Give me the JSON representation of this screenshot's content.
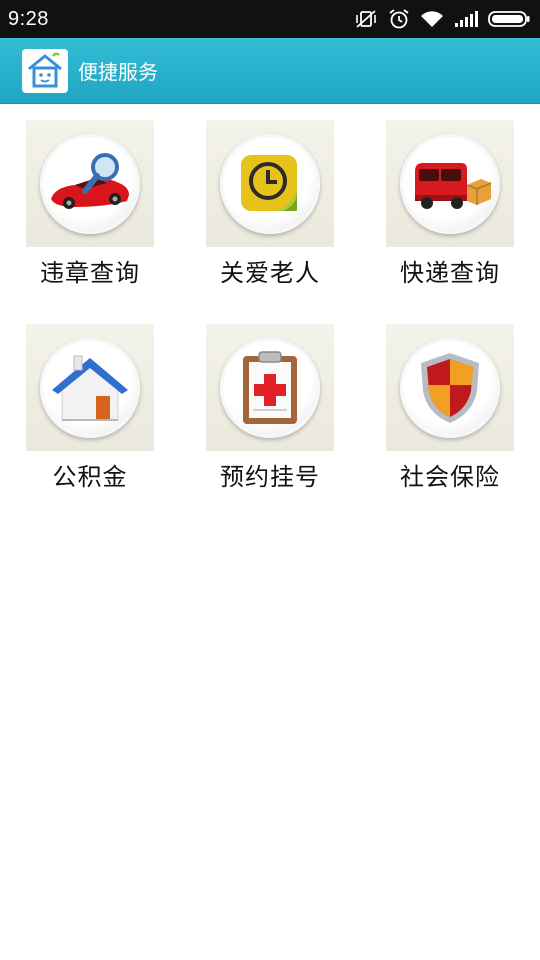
{
  "status_bar": {
    "time": "9:28",
    "icons": [
      "vibrate-off-icon",
      "alarm-icon",
      "wifi-icon",
      "signal-icon",
      "battery-icon"
    ]
  },
  "app_bar": {
    "title": "便捷服务",
    "logo_icon": "house-logo-icon",
    "background": "#25b0cb"
  },
  "services": [
    {
      "label": "违章查询",
      "icon": "car-search-icon"
    },
    {
      "label": "关爱老人",
      "icon": "clock-icon"
    },
    {
      "label": "快递查询",
      "icon": "delivery-truck-icon"
    },
    {
      "label": "公积金",
      "icon": "house-icon"
    },
    {
      "label": "预约挂号",
      "icon": "medical-clipboard-icon"
    },
    {
      "label": "社会保险",
      "icon": "shield-icon"
    }
  ]
}
